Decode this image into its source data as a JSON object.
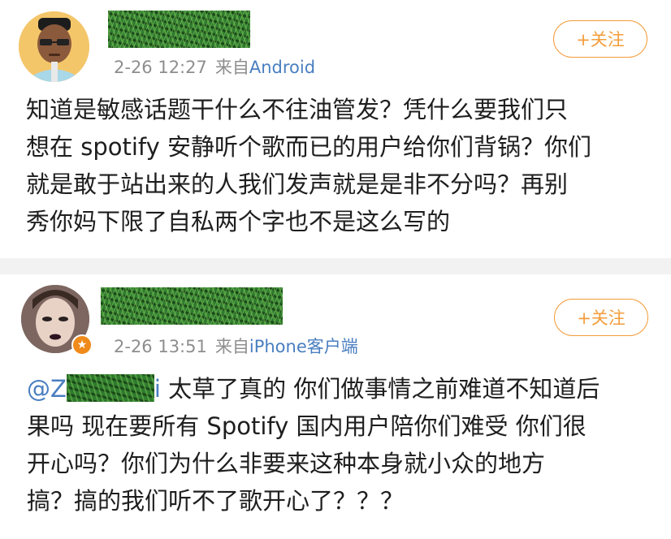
{
  "posts": [
    {
      "timestamp": "2-26 12:27",
      "from_label": "来自",
      "source": "Android",
      "follow_label": "+关注",
      "content_lines": [
        "知道是敏感话题干什么不往油管发？凭什么要我们只",
        "想在 spotify 安静听个歌而已的用户给你们背锅？你们",
        "就是敢于站出来的人我们发声就是是非不分吗？再别",
        "秀你妈下限了自私两个字也不是这么写的"
      ]
    },
    {
      "timestamp": "2-26 13:51",
      "from_label": "来自",
      "source": "iPhone客户端",
      "follow_label": "+关注",
      "mention_prefix": "@Z",
      "mention_suffix": "i",
      "first_line_rest": " 太草了真的 你们做事情之前难道不知道后",
      "content_lines": [
        "果吗 现在要所有 Spotify 国内用户陪你们难受 你们很",
        "开心吗？你们为什么非要来这种本身就小众的地方",
        "搞？搞的我们听不了歌开心了？？？"
      ]
    }
  ],
  "colors": {
    "follow_orange": "#f39c3a",
    "link_blue": "#4a7fc0",
    "meta_gray": "#8e8e8e",
    "separator": "#f2f2f2"
  }
}
